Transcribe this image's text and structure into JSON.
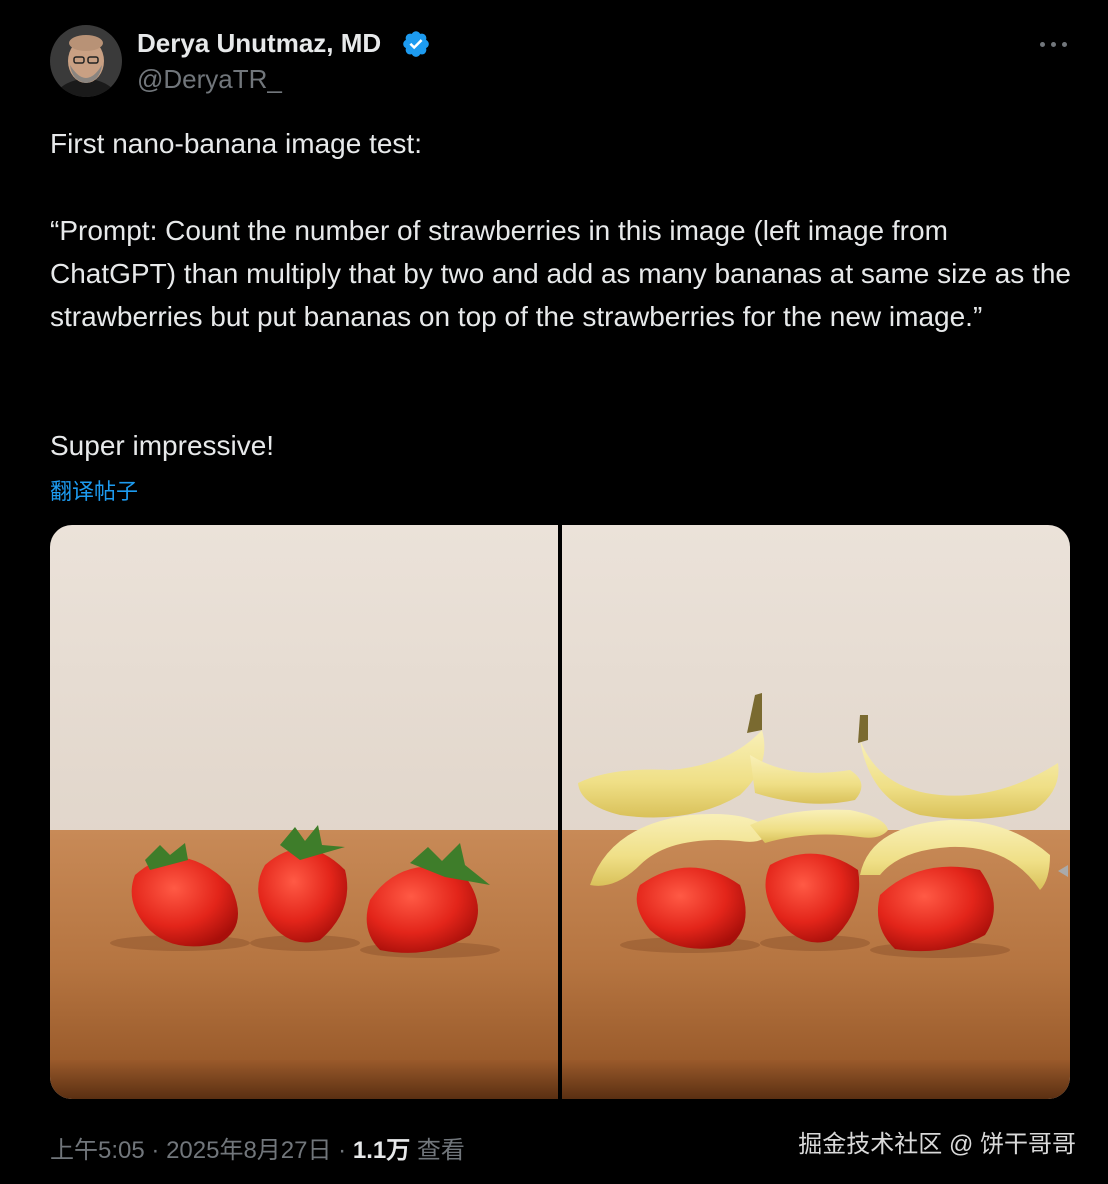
{
  "author": {
    "name": "Derya Unutmaz, MD",
    "handle": "@DeryaTR_",
    "verified_icon": "verified-badge-icon",
    "verified_color": "#1d9bf0"
  },
  "menu_icon": "more-horizontal-icon",
  "post": {
    "line1": "First nano-banana image test:",
    "quote": "“Prompt: Count the number of strawberries in this image (left image from ChatGPT) than multiply that by two and add as many bananas at same size as the strawberries but put bananas on top of the strawberries for the new image.”",
    "closing": "Super impressive!",
    "translate_label": "翻译帖子"
  },
  "media": {
    "left_image": "three strawberries on a wooden table",
    "right_image": "three strawberries with bananas stacked on top on a wooden table"
  },
  "meta": {
    "time": "上午5:05",
    "date": "2025年8月27日",
    "views_count": "1.1万",
    "views_label": "查看",
    "separator": "·"
  },
  "watermark": "掘金技术社区 @ 饼干哥哥",
  "colors": {
    "background": "#000000",
    "primary_text": "#e7e9ea",
    "secondary_text": "#71767b",
    "link": "#1d9bf0"
  }
}
